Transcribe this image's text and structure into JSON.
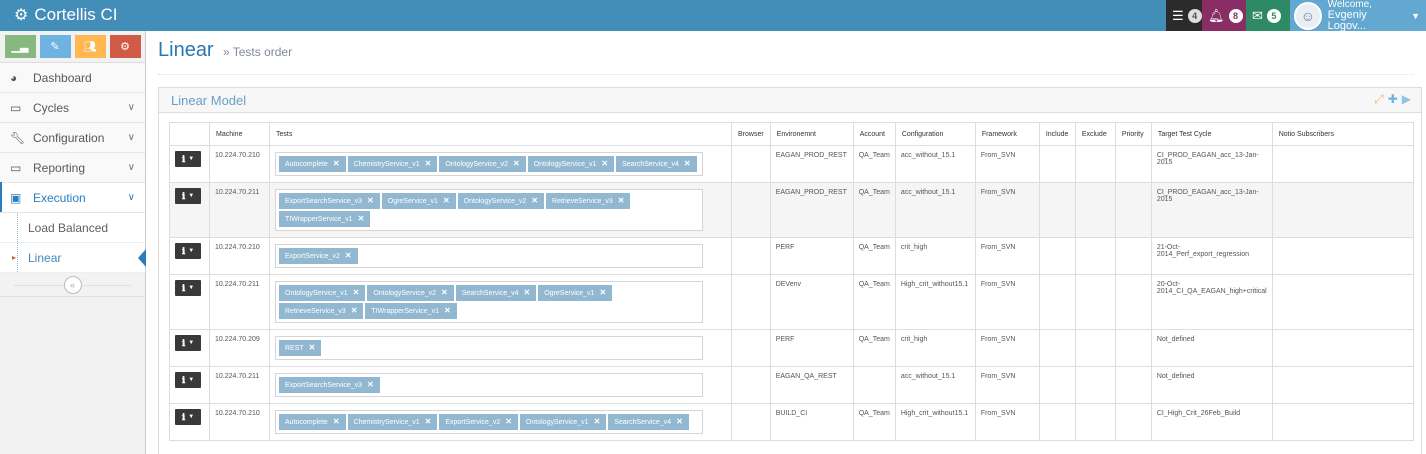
{
  "app": {
    "title": "Cortellis CI"
  },
  "navbar": {
    "tasks_count": "4",
    "notifications_count": "8",
    "messages_count": "5",
    "welcome_line1": "Welcome,",
    "user_name": "Evgeniy Logov..."
  },
  "sidebar": {
    "items": [
      {
        "label": "Dashboard",
        "icon": "dashboard-icon"
      },
      {
        "label": "Cycles",
        "icon": "desktop-icon"
      },
      {
        "label": "Configuration",
        "icon": "wrench-icon"
      },
      {
        "label": "Reporting",
        "icon": "desktop-icon"
      },
      {
        "label": "Execution",
        "icon": "play-square-icon"
      }
    ],
    "submenu": [
      {
        "label": "Load Balanced"
      },
      {
        "label": "Linear"
      }
    ]
  },
  "page": {
    "title": "Linear",
    "subtitle": "» Tests order"
  },
  "widget": {
    "title": "Linear Model"
  },
  "table": {
    "headers": [
      "Machine",
      "Tests",
      "Browser",
      "Environemnt",
      "Account",
      "Configuration",
      "Framework",
      "Include",
      "Exclude",
      "Priority",
      "Target Test Cycle",
      "Notio Subscribers"
    ],
    "rows": [
      {
        "machine": "10.224.70.210",
        "tests": [
          "Autocomplete",
          "ChemistryService_v1",
          "OntologyService_v2",
          "OntologyService_v1",
          "SearchService_v4"
        ],
        "browser": "",
        "env": "EAGAN_PROD_REST",
        "account": "QA_Team",
        "config": "acc_without_15.1",
        "framework": "From_SVN",
        "include": "",
        "exclude": "",
        "priority": "",
        "cycle": "CI_PROD_EAGAN_acc_13-Jan-2015",
        "subs": ""
      },
      {
        "machine": "10.224.70.211",
        "tests": [
          "ExportSearchService_v3",
          "OgreService_v1",
          "OntologyService_v2",
          "RetrieveService_v3",
          "TIWrapperService_v1"
        ],
        "browser": "",
        "env": "EAGAN_PROD_REST",
        "account": "QA_Team",
        "config": "acc_without_15.1",
        "framework": "From_SVN",
        "include": "",
        "exclude": "",
        "priority": "",
        "cycle": "CI_PROD_EAGAN_acc_13-Jan-2015",
        "subs": ""
      },
      {
        "machine": "10.224.70.210",
        "tests": [
          "ExportService_v2"
        ],
        "browser": "",
        "env": "PERF",
        "account": "QA_Team",
        "config": "crit_high",
        "framework": "From_SVN",
        "include": "",
        "exclude": "",
        "priority": "",
        "cycle": "21-Oct-2014_Perf_export_regression",
        "subs": ""
      },
      {
        "machine": "10.224.70.211",
        "tests": [
          "OntologyService_v1",
          "OntologyService_v2",
          "SearchService_v4",
          "OgreService_v1",
          "RetrieveService_v3",
          "TIWrapperService_v1"
        ],
        "browser": "",
        "env": "DEVenv",
        "account": "QA_Team",
        "config": "High_crit_without15.1",
        "framework": "From_SVN",
        "include": "",
        "exclude": "",
        "priority": "",
        "cycle": "20-Oct-2014_CI_QA_EAGAN_high+critical",
        "subs": ""
      },
      {
        "machine": "10.224.70.209",
        "tests": [
          "REST"
        ],
        "browser": "",
        "env": "PERF",
        "account": "QA_Team",
        "config": "crit_high",
        "framework": "From_SVN",
        "include": "",
        "exclude": "",
        "priority": "",
        "cycle": "Not_defined",
        "subs": ""
      },
      {
        "machine": "10.224.70.211",
        "tests": [
          "ExportSearchService_v3"
        ],
        "browser": "",
        "env": "EAGAN_QA_REST",
        "account": "",
        "config": "acc_without_15.1",
        "framework": "From_SVN",
        "include": "",
        "exclude": "",
        "priority": "",
        "cycle": "Not_defined",
        "subs": ""
      },
      {
        "machine": "10.224.70.210",
        "tests": [
          "Autocomplete",
          "ChemistryService_v1",
          "ExportService_v2",
          "OntologyService_v1",
          "SearchService_v4"
        ],
        "browser": "",
        "env": "BUILD_CI",
        "account": "QA_Team",
        "config": "High_crit_without15.1",
        "framework": "From_SVN",
        "include": "",
        "exclude": "",
        "priority": "",
        "cycle": "CI_High_Crit_26Feb_Build",
        "subs": ""
      }
    ]
  },
  "colors": {
    "navbar": "#438eb9",
    "accent": "#2679b5",
    "tag": "#91b8d0"
  }
}
